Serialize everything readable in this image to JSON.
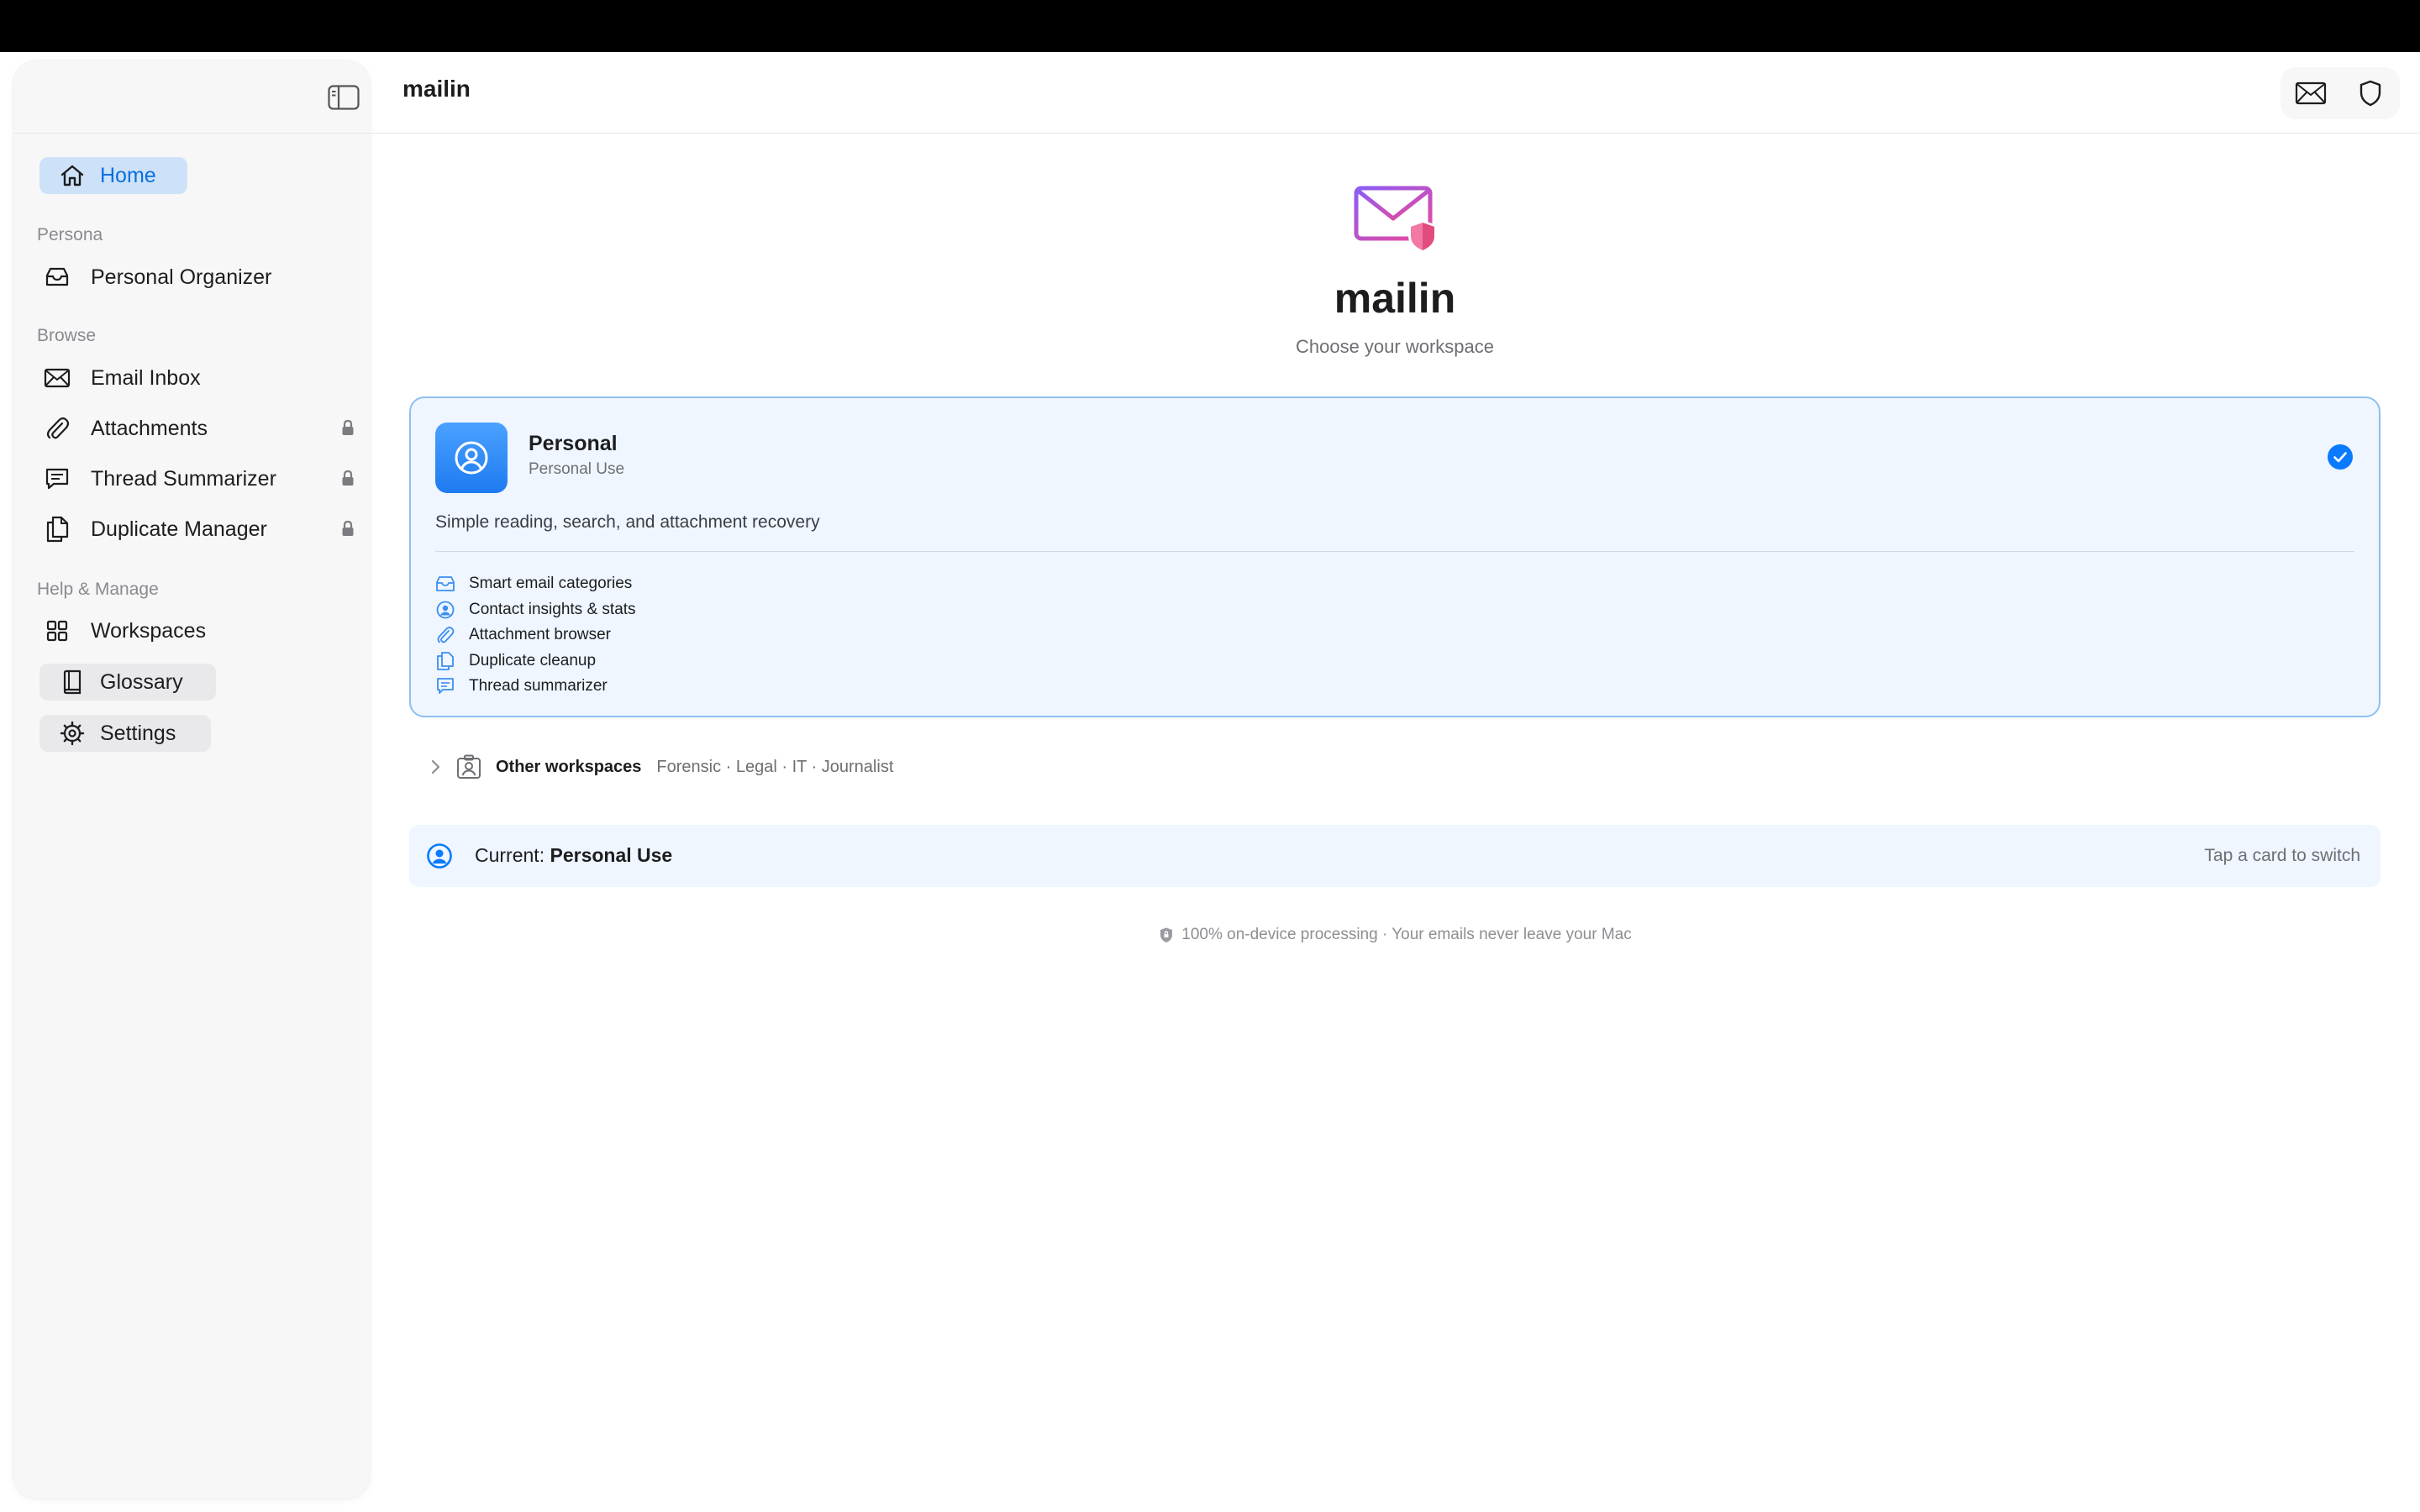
{
  "app": {
    "title": "mailin"
  },
  "sidebar": {
    "home": "Home",
    "sections": {
      "persona": "Persona",
      "browse": "Browse",
      "help": "Help & Manage"
    },
    "persona_item": "Personal Organizer",
    "browse_items": [
      {
        "label": "Email Inbox",
        "icon": "envelope-icon",
        "locked": false
      },
      {
        "label": "Attachments",
        "icon": "paperclip-icon",
        "locked": true
      },
      {
        "label": "Thread Summarizer",
        "icon": "chat-bubble-icon",
        "locked": true
      },
      {
        "label": "Duplicate Manager",
        "icon": "duplicate-icon",
        "locked": true
      }
    ],
    "help_items": {
      "workspaces": "Workspaces",
      "glossary": "Glossary",
      "settings": "Settings"
    }
  },
  "hero": {
    "title": "mailin",
    "subtitle": "Choose your workspace"
  },
  "workspace_card": {
    "title": "Personal",
    "subtitle": "Personal Use",
    "description": "Simple reading, search, and attachment recovery",
    "selected": true,
    "features": [
      {
        "label": "Smart email categories",
        "icon": "tray-icon"
      },
      {
        "label": "Contact insights & stats",
        "icon": "person-circle-icon"
      },
      {
        "label": "Attachment browser",
        "icon": "paperclip-icon"
      },
      {
        "label": "Duplicate cleanup",
        "icon": "duplicate-icon"
      },
      {
        "label": "Thread summarizer",
        "icon": "chat-bubble-icon"
      }
    ]
  },
  "other_workspaces": {
    "label": "Other workspaces",
    "list": "Forensic · Legal · IT · Journalist"
  },
  "current": {
    "prefix": "Current:",
    "value": "Personal Use",
    "hint": "Tap a card to switch"
  },
  "footer": "100% on-device processing · Your emails never leave your Mac",
  "colors": {
    "accent": "#0a6fe0",
    "card_bg": "#eff6ff",
    "card_border": "#8ec0ef",
    "logo_gradient": [
      "#8b5cf6",
      "#ec4899"
    ]
  }
}
